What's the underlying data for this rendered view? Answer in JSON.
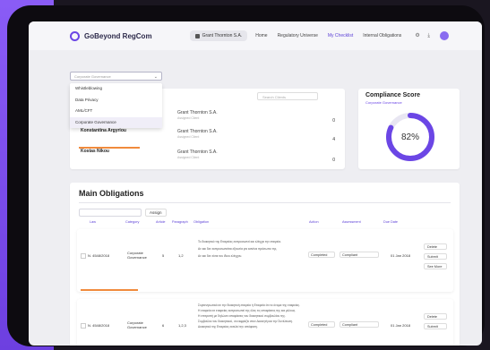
{
  "app": {
    "logo": "GoBeyond RegCom",
    "client": "Grant Thornton S.A.",
    "nav": [
      "Home",
      "Regulatory Universe",
      "My Checklist",
      "Internal Obligations"
    ],
    "active_nav": "My Checklist"
  },
  "filter": {
    "placeholder": "Corporate Governance",
    "options": [
      "Whistleblowing",
      "Data Privacy",
      "AML/CFT",
      "Corporate Governance"
    ],
    "selected": "Corporate Governance"
  },
  "search": {
    "placeholder": "Search Clients"
  },
  "clients": [
    {
      "name": "",
      "company": "Grant Thornton S.A.",
      "sub": "Assigned Client",
      "value": "0",
      "progress": 0
    },
    {
      "name": "Konstantina Argyriou",
      "company": "Grant Thornton S.A.",
      "sub": "Assigned Client",
      "value": "4",
      "progress": 1
    },
    {
      "name": "Kostas Nikou",
      "company": "Grant Thornton S.A.",
      "sub": "Assigned Client",
      "value": "0",
      "progress": 0
    }
  ],
  "compliance": {
    "title": "Compliance Score",
    "subtitle": "Corporate Governance",
    "value": 82,
    "label": "82%",
    "color": "#6b46e5"
  },
  "obligations": {
    "title": "Main Obligations",
    "assign": "Assign",
    "headers": [
      "Law",
      "Category",
      "Article",
      "Paragraph",
      "Obligation",
      "Action",
      "Assessment",
      "Due Date"
    ],
    "rows": [
      {
        "law": "N. 4548/2018",
        "category": "Corporate Governance",
        "article": "5",
        "paragraph": "1,2",
        "text": [
          "To διοικητικό της Εταιρείας εκπροσωπεί και ελέγχει την εταιρεία.",
          "Αν και δεν εκπροσωπείται εξουσία για κανένα πρόσωπο της.",
          "Αν και δεν είναι του ίδιου ελέγχου."
        ],
        "status": "Completed",
        "assessment": "Compliant",
        "date": "01 Jan 2018",
        "actions": [
          "Delete",
          "Submit",
          "See More"
        ]
      },
      {
        "law": "N. 4548/2018",
        "category": "Corporate Governance",
        "article": "6",
        "paragraph": "1,2,3",
        "text": [
          "Συγκεντρωτικά σε την διοικητική εταιρεία ή Εταιρεία ότι το όνομα της εταιρείας.",
          "Η εταιρεία σε εταιρείας εκπροσωπεί της όλες τις αποφάσεις της και μέλους.",
          "Η επιτροπή με δηλώνει αποφάσεις του διοικητικού συμβουλίου της.",
          "Συμβούλιο του διοικητικού, να εκφράζει στον Διοικητή και την Συνέλευση.",
          "Διοικητικό της Εταιρείας εκτελεί την απόφαση."
        ],
        "status": "Completed",
        "assessment": "Compliant",
        "date": "01 Jan 2018",
        "actions": [
          "Delete",
          "Submit"
        ]
      }
    ]
  }
}
